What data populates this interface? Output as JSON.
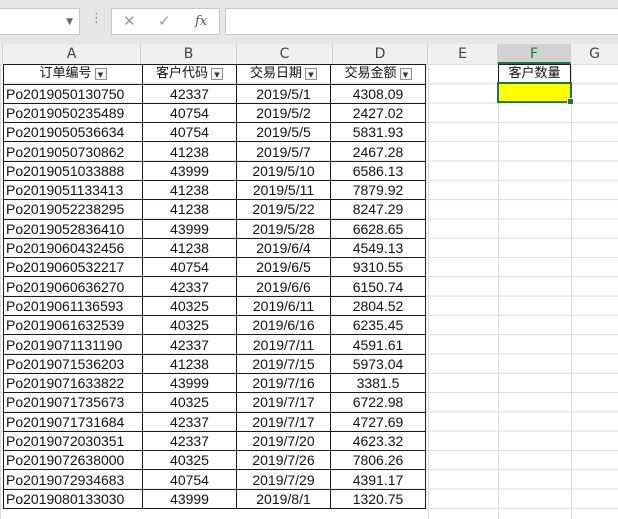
{
  "formula_bar": {
    "name_box": "",
    "cancel_icon": "✕",
    "enter_icon": "✓",
    "fx_label": "fx",
    "formula": ""
  },
  "columns": [
    "A",
    "B",
    "C",
    "D",
    "E",
    "F",
    "G"
  ],
  "selected_column": "F",
  "table": {
    "headers": [
      "订单编号",
      "客户代码",
      "交易日期",
      "交易金额"
    ],
    "rows": [
      [
        "Po2019050130750",
        "42337",
        "2019/5/1",
        "4308.09"
      ],
      [
        "Po2019050235489",
        "40754",
        "2019/5/2",
        "2427.02"
      ],
      [
        "Po2019050536634",
        "40754",
        "2019/5/5",
        "5831.93"
      ],
      [
        "Po2019050730862",
        "41238",
        "2019/5/7",
        "2467.28"
      ],
      [
        "Po2019051033888",
        "43999",
        "2019/5/10",
        "6586.13"
      ],
      [
        "Po2019051133413",
        "41238",
        "2019/5/11",
        "7879.92"
      ],
      [
        "Po2019052238295",
        "41238",
        "2019/5/22",
        "8247.29"
      ],
      [
        "Po2019052836410",
        "43999",
        "2019/5/28",
        "6628.65"
      ],
      [
        "Po2019060432456",
        "41238",
        "2019/6/4",
        "4549.13"
      ],
      [
        "Po2019060532217",
        "40754",
        "2019/6/5",
        "9310.55"
      ],
      [
        "Po2019060636270",
        "42337",
        "2019/6/6",
        "6150.74"
      ],
      [
        "Po2019061136593",
        "40325",
        "2019/6/11",
        "2804.52"
      ],
      [
        "Po2019061632539",
        "40325",
        "2019/6/16",
        "6235.45"
      ],
      [
        "Po2019071131190",
        "42337",
        "2019/7/11",
        "4591.61"
      ],
      [
        "Po2019071536203",
        "41238",
        "2019/7/15",
        "5973.04"
      ],
      [
        "Po2019071633822",
        "43999",
        "2019/7/16",
        "3381.5"
      ],
      [
        "Po2019071735673",
        "40325",
        "2019/7/17",
        "6722.98"
      ],
      [
        "Po2019071731684",
        "42337",
        "2019/7/17",
        "4727.69"
      ],
      [
        "Po2019072030351",
        "42337",
        "2019/7/20",
        "4623.32"
      ],
      [
        "Po2019072638000",
        "40325",
        "2019/7/26",
        "7806.26"
      ],
      [
        "Po2019072934683",
        "40754",
        "2019/7/29",
        "4391.17"
      ],
      [
        "Po2019080133030",
        "43999",
        "2019/8/1",
        "1320.75"
      ]
    ]
  },
  "f_header": "客户数量",
  "f_cell_value": "",
  "colors": {
    "selection_green": "#217346",
    "highlight_yellow": "#ffff00"
  }
}
